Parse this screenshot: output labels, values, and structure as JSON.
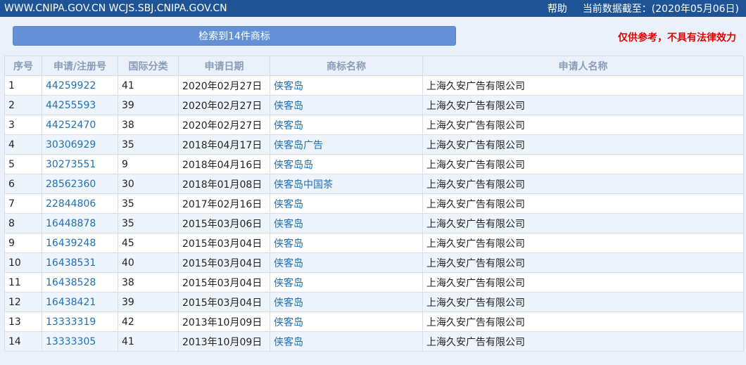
{
  "header": {
    "site": "WWW.CNIPA.GOV.CN WCJS.SBJ.CNIPA.GOV.CN",
    "help": "帮助",
    "data_date": "当前数据截至：(2020年05月06日)"
  },
  "toolbar": {
    "summary": "检索到14件商标",
    "disclaimer": "仅供参考，不具有法律效力"
  },
  "table": {
    "columns": [
      "序号",
      "申请/注册号",
      "国际分类",
      "申请日期",
      "商标名称",
      "申请人名称"
    ],
    "rows": [
      [
        "1",
        "44259922",
        "41",
        "2020年02月27日",
        "侠客岛",
        "上海久安广告有限公司"
      ],
      [
        "2",
        "44255593",
        "39",
        "2020年02月27日",
        "侠客岛",
        "上海久安广告有限公司"
      ],
      [
        "3",
        "44252470",
        "38",
        "2020年02月27日",
        "侠客岛",
        "上海久安广告有限公司"
      ],
      [
        "4",
        "30306929",
        "35",
        "2018年04月17日",
        "侠客岛广告",
        "上海久安广告有限公司"
      ],
      [
        "5",
        "30273551",
        "9",
        "2018年04月16日",
        "侠客岛岛",
        "上海久安广告有限公司"
      ],
      [
        "6",
        "28562360",
        "30",
        "2018年01月08日",
        "侠客岛中国茶",
        "上海久安广告有限公司"
      ],
      [
        "7",
        "22844806",
        "35",
        "2017年02月16日",
        "侠客岛",
        "上海久安广告有限公司"
      ],
      [
        "8",
        "16448878",
        "35",
        "2015年03月06日",
        "侠客岛",
        "上海久安广告有限公司"
      ],
      [
        "9",
        "16439248",
        "45",
        "2015年03月04日",
        "侠客岛",
        "上海久安广告有限公司"
      ],
      [
        "10",
        "16438531",
        "40",
        "2015年03月04日",
        "侠客岛",
        "上海久安广告有限公司"
      ],
      [
        "11",
        "16438528",
        "38",
        "2015年03月04日",
        "侠客岛",
        "上海久安广告有限公司"
      ],
      [
        "12",
        "16438421",
        "39",
        "2015年03月04日",
        "侠客岛",
        "上海久安广告有限公司"
      ],
      [
        "13",
        "13333319",
        "42",
        "2013年10月09日",
        "侠客岛",
        "上海久安广告有限公司"
      ],
      [
        "14",
        "13333305",
        "41",
        "2013年10月09日",
        "侠客岛",
        "上海久安广告有限公司"
      ]
    ]
  }
}
